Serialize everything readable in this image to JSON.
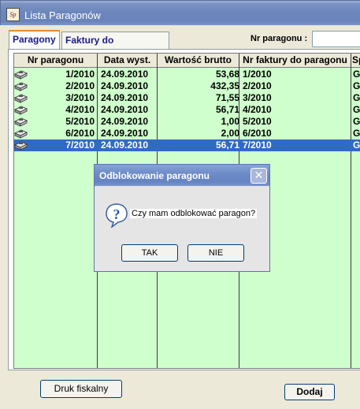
{
  "window": {
    "title": "Lista Paragonów",
    "icon_text": "Sp"
  },
  "tabs": [
    {
      "label": "Paragony",
      "active": true
    },
    {
      "label": "Faktury do paragonów",
      "active": false
    }
  ],
  "search": {
    "label": "Nr paragonu :",
    "value": ""
  },
  "table": {
    "columns": [
      "Nr paragonu",
      "Data wyst.",
      "Wartość brutto",
      "Nr faktury do paragonu",
      "Sp"
    ],
    "rows": [
      {
        "nr": "1/2010",
        "date": "24.09.2010",
        "value": "53,68",
        "faktura": "1/2010",
        "sp": "G"
      },
      {
        "nr": "2/2010",
        "date": "24.09.2010",
        "value": "432,35",
        "faktura": "2/2010",
        "sp": "G"
      },
      {
        "nr": "3/2010",
        "date": "24.09.2010",
        "value": "71,55",
        "faktura": "3/2010",
        "sp": "G"
      },
      {
        "nr": "4/2010",
        "date": "24.09.2010",
        "value": "56,71",
        "faktura": "4/2010",
        "sp": "G"
      },
      {
        "nr": "5/2010",
        "date": "24.09.2010",
        "value": "1,00",
        "faktura": "5/2010",
        "sp": "G"
      },
      {
        "nr": "6/2010",
        "date": "24.09.2010",
        "value": "2,00",
        "faktura": "6/2010",
        "sp": "G"
      },
      {
        "nr": "7/2010",
        "date": "24.09.2010",
        "value": "56,71",
        "faktura": "7/2010",
        "sp": "G"
      }
    ],
    "selected_row": 6,
    "row_color": "#cfffcc",
    "selected_color": "#316ac5"
  },
  "buttons": {
    "druk": "Druk fiskalny",
    "dodaj": "Dodaj"
  },
  "dialog": {
    "title": "Odblokowanie paragonu",
    "message": "Czy mam odblokować paragon?",
    "yes": "TAK",
    "no": "NIE",
    "icon": "question-icon",
    "close_glyph": "✕"
  }
}
